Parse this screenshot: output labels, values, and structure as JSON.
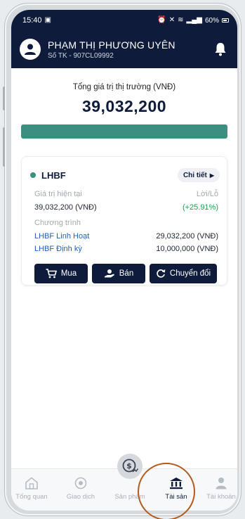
{
  "status_bar": {
    "time": "15:40",
    "battery": "60%"
  },
  "header": {
    "user_name": "PHẠM THỊ PHƯƠNG UYÊN",
    "account_no": "Số TK - 907CL09992"
  },
  "summary": {
    "total_label": "Tổng giá trị thị trường (VNĐ)",
    "total_value": "39,032,200",
    "bar_fill_fraction": 1.0,
    "bar_color": "#3a8f7f"
  },
  "fund_card": {
    "fund_name": "LHBF",
    "detail_label": "Chi tiết",
    "current_value_label": "Giá trị hiện tại",
    "profit_label": "Lời/Lỗ",
    "current_value": "39,032,200 (VNĐ)",
    "profit_value": "(+25.91%)",
    "program_label": "Chương trình",
    "programs": [
      {
        "name": "LHBF Linh Hoạt",
        "value": "29,032,200 (VNĐ)"
      },
      {
        "name": "LHBF Định kỳ",
        "value": "10,000,000 (VNĐ)"
      }
    ],
    "buttons": {
      "buy": "Mua",
      "sell": "Bán",
      "switch": "Chuyển đổi"
    }
  },
  "bottom_nav": {
    "items": [
      {
        "label": "Tổng quan",
        "icon": "home-icon"
      },
      {
        "label": "Giao dịch",
        "icon": "transaction-icon"
      },
      {
        "label": "Sản phẩm",
        "icon": "product-coin-icon"
      },
      {
        "label": "Tài sản",
        "icon": "bank-icon"
      },
      {
        "label": "Tài khoản",
        "icon": "user-icon"
      }
    ],
    "active": "Tài sản"
  },
  "colors": {
    "primary": "#0f1b3a",
    "accent": "#3a8f7f",
    "profit": "#1aa34a",
    "link": "#1e5fb8",
    "annotation_ring": "#b45a1c"
  }
}
